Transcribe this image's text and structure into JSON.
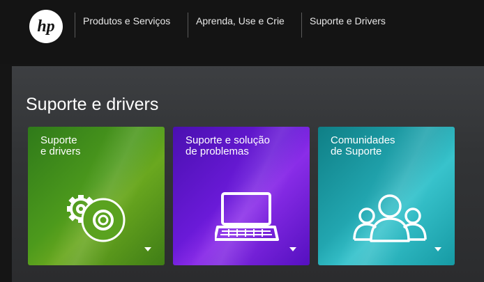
{
  "header": {
    "logo_text": "hp",
    "nav": [
      {
        "label": "Produtos e Serviços"
      },
      {
        "label": "Aprenda, Use e Crie"
      },
      {
        "label": "Suporte e Drivers"
      }
    ]
  },
  "main": {
    "title": "Suporte e drivers",
    "tiles": [
      {
        "line1": "Suporte",
        "line2": "e drivers",
        "icon": "gear-disc-icon",
        "color": "#4d9a1c"
      },
      {
        "line1": "Suporte e solução",
        "line2": "de problemas",
        "icon": "laptop-icon",
        "color": "#6a1ad8"
      },
      {
        "line1": "Comunidades",
        "line2": "de Suporte",
        "icon": "people-icon",
        "color": "#22a6b0"
      }
    ]
  }
}
